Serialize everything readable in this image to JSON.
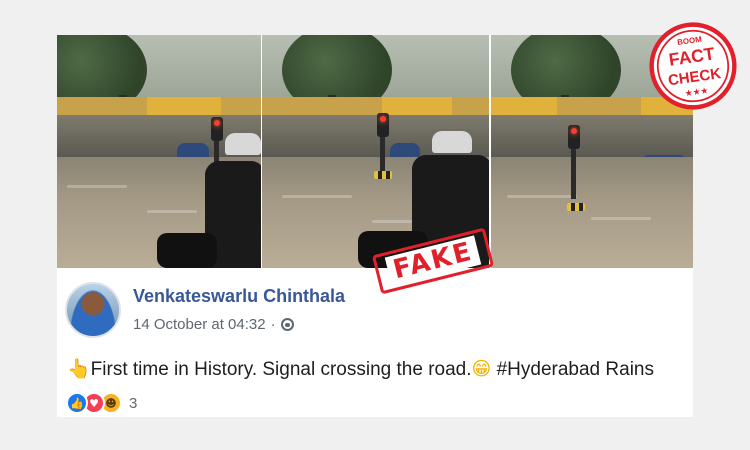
{
  "overlay": {
    "fake_stamp": "FAKE",
    "seal": {
      "top": "BOOM",
      "line1": "FACT",
      "line2": "CHECK",
      "stars": "★★★",
      "color": "#e0202a"
    }
  },
  "post": {
    "author": "Venkateswarlu Chinthala",
    "timestamp": "14 October at 04:32",
    "separator": "·",
    "privacy_icon": "globe-icon",
    "message_emoji_start": "👆",
    "message_text": "First time in History. Signal crossing the road.",
    "message_emoji_mid": "😁",
    "message_hashtag": " #Hyderabad Rains",
    "reactions": {
      "icons": [
        "like-icon",
        "love-icon",
        "haha-icon"
      ],
      "count": "3"
    },
    "link_color": "#385898"
  }
}
